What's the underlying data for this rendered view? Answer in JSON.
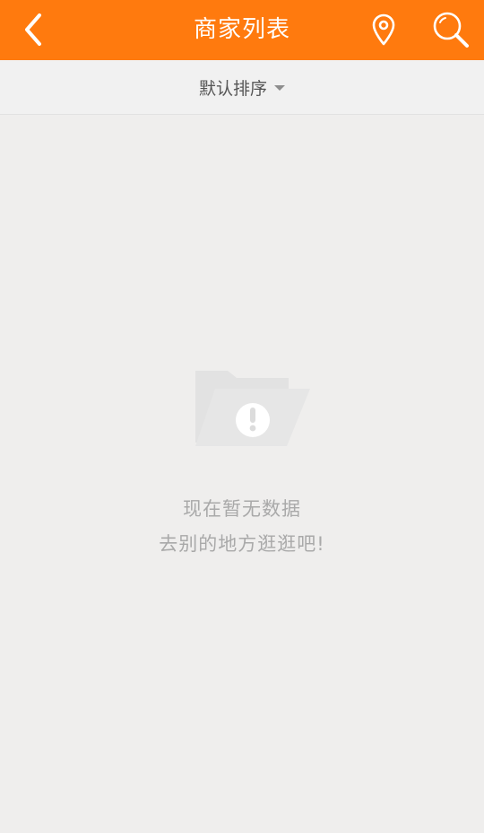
{
  "header": {
    "title": "商家列表",
    "icons": {
      "back": "chevron-left-icon",
      "location": "location-pin-icon",
      "search": "search-icon"
    }
  },
  "sort": {
    "label": "默认排序"
  },
  "empty_state": {
    "icon": "folder-alert-icon",
    "line1": "现在暂无数据",
    "line2": "去别的地方逛逛吧!"
  },
  "colors": {
    "header_bg": "#ff7a0e",
    "page_bg": "#efeeed",
    "empty_text": "#a9a9a9"
  }
}
